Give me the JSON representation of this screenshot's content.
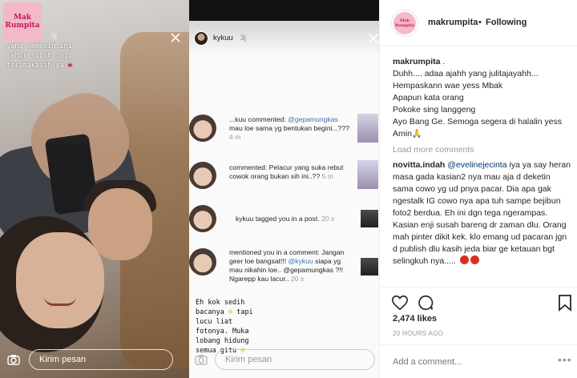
{
  "story_left": {
    "logo": {
      "line1": "Mak",
      "line2": "Rumpita"
    },
    "time": "9j",
    "caption": "yang nemenin ini\nsahur subuh ini,\nterimakasih ya",
    "heart": "❤",
    "send_placeholder": "Kirim pesan",
    "camera_icon": "camera-icon",
    "close_icon": "close-icon"
  },
  "story_right": {
    "username": "kykuu",
    "time": "3j",
    "notifications": [
      {
        "user": "...kuu",
        "text": "commented: ",
        "mention": "@gepamungkas",
        "rest": " mau loe sama yg bentukan begini...???",
        "time": "4 m"
      },
      {
        "user": "",
        "text": "commented: Pelacur yang suka rebut cowok orang bukan sih ini..??",
        "mention": "",
        "rest": "",
        "time": "5 m"
      },
      {
        "user": "",
        "text": "kykuu tagged you in a post.",
        "mention": "",
        "rest": "",
        "time": "20 s"
      },
      {
        "user": "",
        "text": "mentioned you in a comment: Jangan geer loe bangsat!!! ",
        "mention": "@kykuu",
        "rest": " siapa yg mau nikahin loe.. @gepamungkas ?!! Ngarepp kau lacur..",
        "time": "20 s"
      }
    ],
    "note": "Eh kok sedih\nbacanya",
    "note2": "tapi\nlucu liat\nfotonya. Muka\nlobang hidung\nsemua gitu",
    "send_placeholder": "Kirim pesan"
  },
  "panel": {
    "username": "makrumpita",
    "dot": "•",
    "follow_status": "Following",
    "caption_user": "makrumpita",
    "caption_lines": [
      "Duhh.... adaa ajahh yang julitajayahh...",
      "Hempaskann wae yess Mbak",
      "Apapun kata orang",
      "Pokoke sing langgeng",
      "Ayo Bang Ge. Semoga segera di halalin yess",
      "Amin🙏"
    ],
    "load_more": "Load more comments",
    "comment2_user": "novitta.indah",
    "comment2_mention": "@evelinejecinta",
    "comment2_text": "iya ya say heran masa gada kasian2 nya mau aja d deketin sama cowo yg ud pnya pacar. Dia apa gak ngestalk IG cowo nya apa tuh sampe bejibun foto2 berdua. Eh ini dgn tega ngerampas. Kasian enji susah bareng dr zaman dlu. Orang mah pinter dikit kek. klo emang ud pacaran jgn d publish dlu kasih jeda biar ge ketauan bgt selingkuh nya.....",
    "likes": "2,474 likes",
    "time_ago": "20 HOURS AGO",
    "add_comment_placeholder": "Add a comment...",
    "more_label": "•••"
  }
}
